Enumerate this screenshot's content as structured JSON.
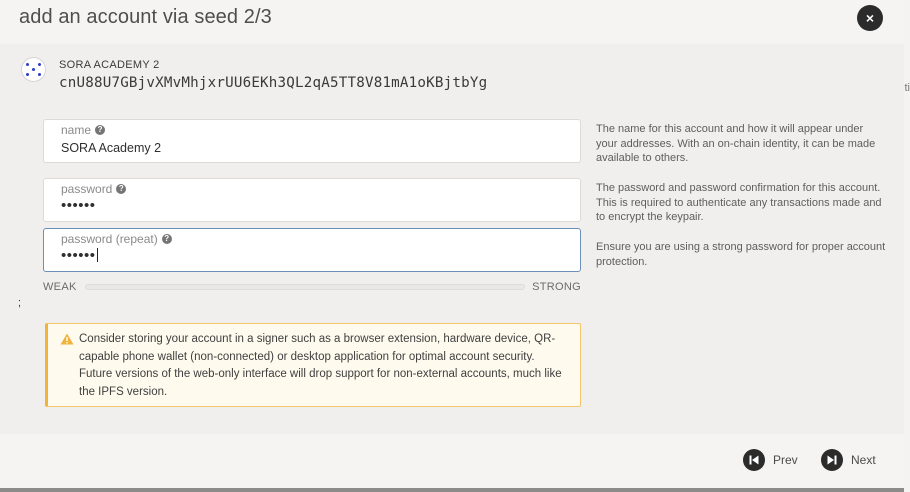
{
  "modal": {
    "title": "add an account via seed 2/3",
    "close_icon": "×"
  },
  "account": {
    "name": "SORA ACADEMY 2",
    "address": "cnU88U7GBjvXMvMhjxrUU6EKh3QL2qA5TT8V81mA1oKBjtbYg"
  },
  "fields": {
    "name": {
      "label": "name",
      "value": "SORA Academy 2"
    },
    "password": {
      "label": "password",
      "value": "••••••"
    },
    "password_repeat": {
      "label": "password (repeat)",
      "value": "••••••"
    }
  },
  "help": {
    "name": "The name for this account and how it will appear under your addresses. With an on-chain identity, it can be made available to others.",
    "password": "The password and password confirmation for this account. This is required to authenticate any transactions made and to encrypt the keypair.",
    "password_repeat": "Ensure you are using a strong password for proper account protection."
  },
  "strength": {
    "weak_label": "WEAK",
    "strong_label": "STRONG",
    "level": 0
  },
  "stray_char": ";",
  "warning": {
    "icon": "warning-triangle-icon",
    "text": "Consider storing your account in a signer such as a browser extension, hardware device, QR-capable phone wallet (non-connected) or desktop application for optimal account security. Future versions of the web-only interface will drop support for non-external accounts, much like the IPFS version."
  },
  "footer": {
    "prev_label": "Prev",
    "next_label": "Next"
  },
  "colors": {
    "accent_dark": "#2b2b2b",
    "warning_border": "#f0b43c",
    "focus_border": "#6e8fb8"
  }
}
